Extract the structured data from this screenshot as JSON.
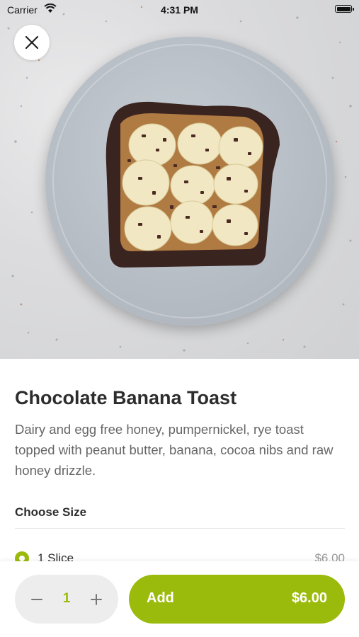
{
  "status_bar": {
    "carrier": "Carrier",
    "time": "4:31 PM"
  },
  "product": {
    "name": "Chocolate Banana Toast",
    "description": "Dairy and egg free honey, pumpernickel, rye toast topped with peanut butter, banana, cocoa nibs and raw honey drizzle."
  },
  "size_section": {
    "title": "Choose Size",
    "options": [
      {
        "label": "1 Slice",
        "price": "$6.00",
        "selected": true
      }
    ]
  },
  "cart": {
    "quantity": "1",
    "add_label": "Add",
    "total": "$6.00"
  },
  "colors": {
    "accent": "#9bbb0c",
    "stepper_bg": "#ededed"
  },
  "icons": {
    "close": "close-icon",
    "minus": "minus-icon",
    "plus": "plus-icon",
    "wifi": "wifi-icon",
    "battery": "battery-icon"
  }
}
